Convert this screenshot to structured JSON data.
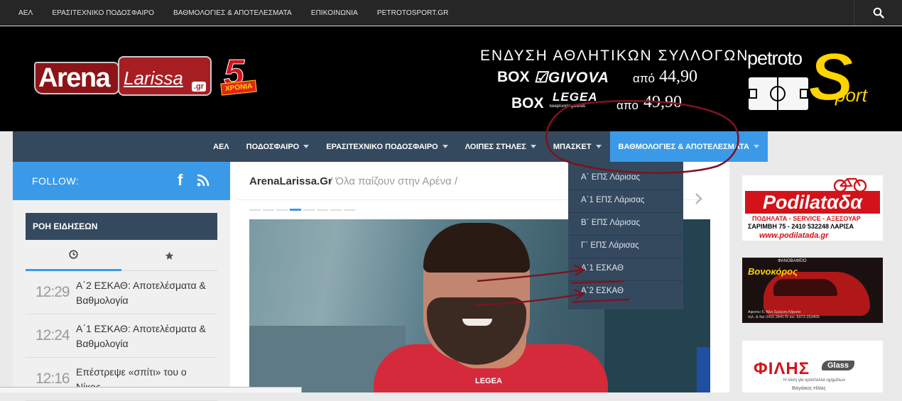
{
  "topbar": {
    "links": [
      "ΑΕΛ",
      "ΕΡΑΣΙΤΕΧΝΙΚΟ ΠΟΔΟΣΦΑΙΡΟ",
      "ΒΑΘΜΟΛΟΓΙΕΣ & ΑΠΟΤΕΛΕΣΜΑΤΑ",
      "ΕΠΙΚΟΙΝΩΝΙΑ",
      "PETROTOSPORT.GR"
    ],
    "search_icon": "search-icon"
  },
  "header": {
    "logo_arena": "Arena",
    "logo_larissa": "Larissa",
    "logo_gr": ".gr",
    "badge_num": "5",
    "badge_text": "ΧΡΟΝΙΑ",
    "ad": {
      "line1": "ΕΝΔΥΣΗ ΑΘΛΗΤΙΚΩΝ ΣΥΛΛΟΓΩΝ",
      "box": "BOX",
      "brand1": "☑GIVOVA",
      "apo": "από",
      "price1": "44,90",
      "brand2": "LEGEA",
      "brand2_tag": "keeprunningwithus",
      "price2": "49,90"
    },
    "sponsor_word": "petroto",
    "sponsor_s": "S",
    "sponsor_port": "port"
  },
  "nav": {
    "items": [
      {
        "label": "ΑΕΛ",
        "caret": false
      },
      {
        "label": "ΠΟΔΟΣΦΑΙΡΟ",
        "caret": true
      },
      {
        "label": "ΕΡΑΣΙΤΕΧΝΙΚΟ ΠΟΔΟΣΦΑΙΡΟ",
        "caret": true
      },
      {
        "label": "ΛΟΙΠΕΣ ΣΤΗΛΕΣ",
        "caret": true
      },
      {
        "label": "ΜΠΑΣΚΕΤ",
        "caret": true
      },
      {
        "label": "ΒΑΘΜΟΛΟΓΙΕΣ & ΑΠΟΤΕΛΕΣΜΑΤΑ",
        "caret": true
      }
    ],
    "dropdown": [
      "Α΄ ΕΠΣ Λάρισας",
      "Α΄1 ΕΠΣ Λάρισας",
      "Β΄ ΕΠΣ Λάρισας",
      "Γ΄ ΕΠΣ Λάρισας",
      "Α΄1 ΕΣΚΑΘ",
      "Α΄2 ΕΣΚΑΘ"
    ]
  },
  "sidebar": {
    "follow_label": "FOLLOW:",
    "facebook_glyph": "f",
    "ticker_title": "ΡΟΗ ΕΙΔΗΣΕΩΝ",
    "news": [
      {
        "time": "12:29",
        "title": "Α΄2 ΕΣΚΑΘ: Αποτελέσματα & Βαθμολογία"
      },
      {
        "time": "12:24",
        "title": "Α΄1 ΕΣΚΑΘ: Αποτελέσματα & Βαθμολογία"
      },
      {
        "time": "12:16",
        "title": "Επέστρεψε «σπίτι» του ο Νίκος"
      }
    ]
  },
  "content": {
    "site": "ArenaLarissa.Gr",
    "tagline": "/ Όλα παίζουν στην Αρένα /",
    "slider_total": 8,
    "slider_active": 4,
    "photo_jersey_text": "LEGEA"
  },
  "ads": {
    "podilatada": {
      "name": "Podilatαδα",
      "line1": "ΠΟΔΗΛΑΤΑ - SERVICE - ΑΞΕΣΟΥΑΡ",
      "line2": "ΣΑΡΙΜΒΗ 75 - 2410 532248 ΛΑΡΙΣΑ",
      "url": "www.podilatada.gr"
    },
    "vonokoros": {
      "tag": "ΦΑΝΟΒΑΦΕΙΟ",
      "name": "Βονοκόρος",
      "addr1": "Αφισου 5, Νέα Σμύρνη Λάρισα",
      "addr2": "τηλ. & fax 2410 284176 κιν. 6973 253405"
    },
    "filis": {
      "name": "ΦΙΛΗΣ",
      "glass": "Glass",
      "sub": "Η λύση για κρύσταλλα οχημάτων",
      "sub2": "Βαγιόκος Ηλίας"
    }
  },
  "status": "",
  "colors": {
    "accent": "#3b9ae8",
    "nav": "#34495e",
    "annotation": "#7b1420"
  }
}
